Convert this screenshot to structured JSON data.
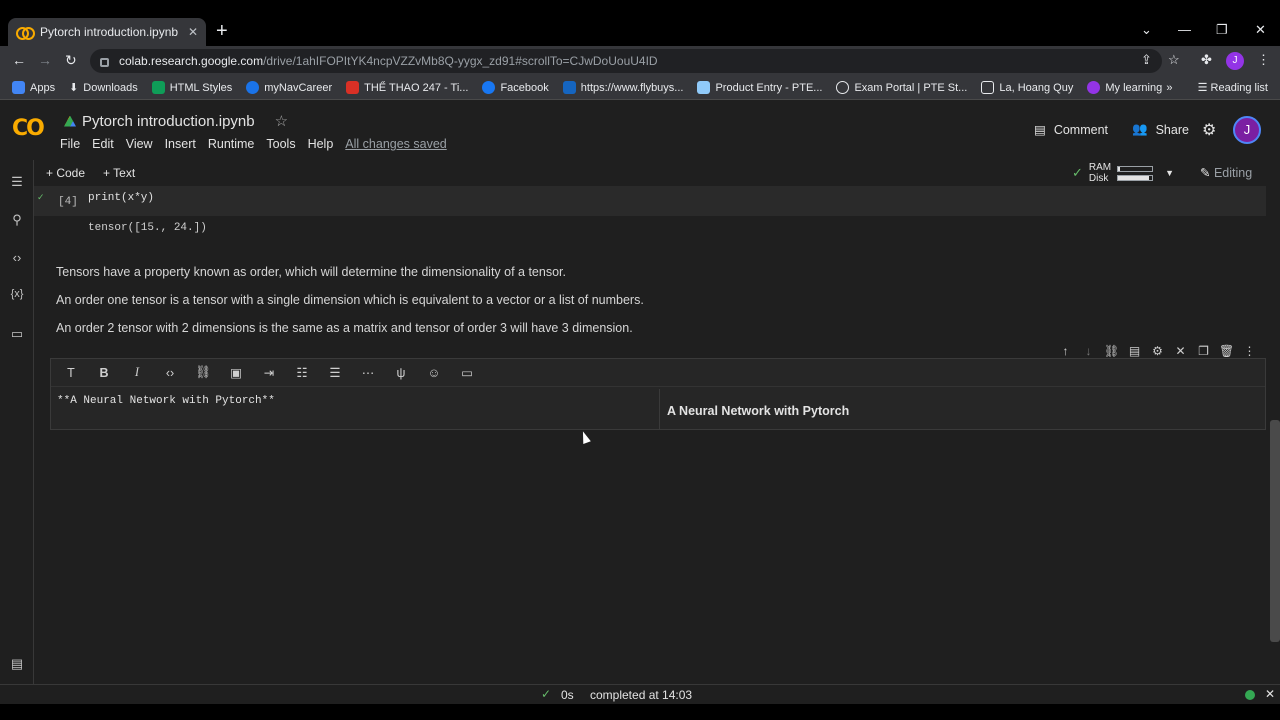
{
  "browser": {
    "tab_title": "Pytorch introduction.ipynb - Cola",
    "tab_close": "✕",
    "new_tab": "+",
    "url_host": "colab.research.google.com",
    "url_path": "/drive/1ahIFOPItYK4ncpVZZvMb8Q-yygx_zd91#scrollTo=CJwDoUouU4ID",
    "profile_initial": "J",
    "window_controls": [
      "⌄",
      "—",
      "❐",
      "✕"
    ]
  },
  "bookmarks": {
    "items": [
      {
        "label": "Apps",
        "color": "#4285f4"
      },
      {
        "label": "Downloads",
        "color": "#e8eaed"
      },
      {
        "label": "HTML Styles",
        "color": "#0f9d58"
      },
      {
        "label": "myNavCareer",
        "color": "#1a73e8"
      },
      {
        "label": "THỂ THAO 247 - Ti...",
        "color": "#d93025"
      },
      {
        "label": "Facebook",
        "color": "#1877f2"
      },
      {
        "label": "https://www.flybuys...",
        "color": "#1565c0"
      },
      {
        "label": "Product Entry - PTE...",
        "color": "#90caf9"
      },
      {
        "label": "Exam Portal | PTE St...",
        "color": "#e8eaed"
      },
      {
        "label": "La, Hoang Quy",
        "color": "#e8eaed"
      },
      {
        "label": "My learning",
        "color": "#9334e6"
      }
    ],
    "overflow": "»",
    "reading_list": "Reading list"
  },
  "colab": {
    "logo": "CO",
    "title": "Pytorch introduction.ipynb",
    "menu": [
      "File",
      "Edit",
      "View",
      "Insert",
      "Runtime",
      "Tools",
      "Help"
    ],
    "saved_status": "All changes saved",
    "comment_label": "Comment",
    "share_label": "Share",
    "user_initial": "J"
  },
  "cell_toolbar": {
    "add_code": "+ Code",
    "add_text": "+ Text",
    "ram_label": "RAM",
    "disk_label": "Disk",
    "ram_usage": 0.05,
    "disk_usage": 0.9,
    "editing_label": "Editing"
  },
  "notebook": {
    "code_cell": {
      "exec_count": "[4]",
      "source": "print(x*y)",
      "output": "tensor([15., 24.])"
    },
    "text_cell_lines": [
      "Tensors have a property known as order, which will determine the dimensionality of a tensor.",
      "An order one tensor is a tensor with a single dimension which is equivalent to a vector or a list of numbers.",
      "An order 2 tensor with 2 dimensions is the same as a matrix and tensor of order 3 will have 3 dimension."
    ],
    "md_editor": {
      "source": "**A Neural Network with Pytorch**",
      "preview": "A Neural Network with Pytorch"
    }
  },
  "statusbar": {
    "duration": "0s",
    "message": "completed at 14:03"
  }
}
